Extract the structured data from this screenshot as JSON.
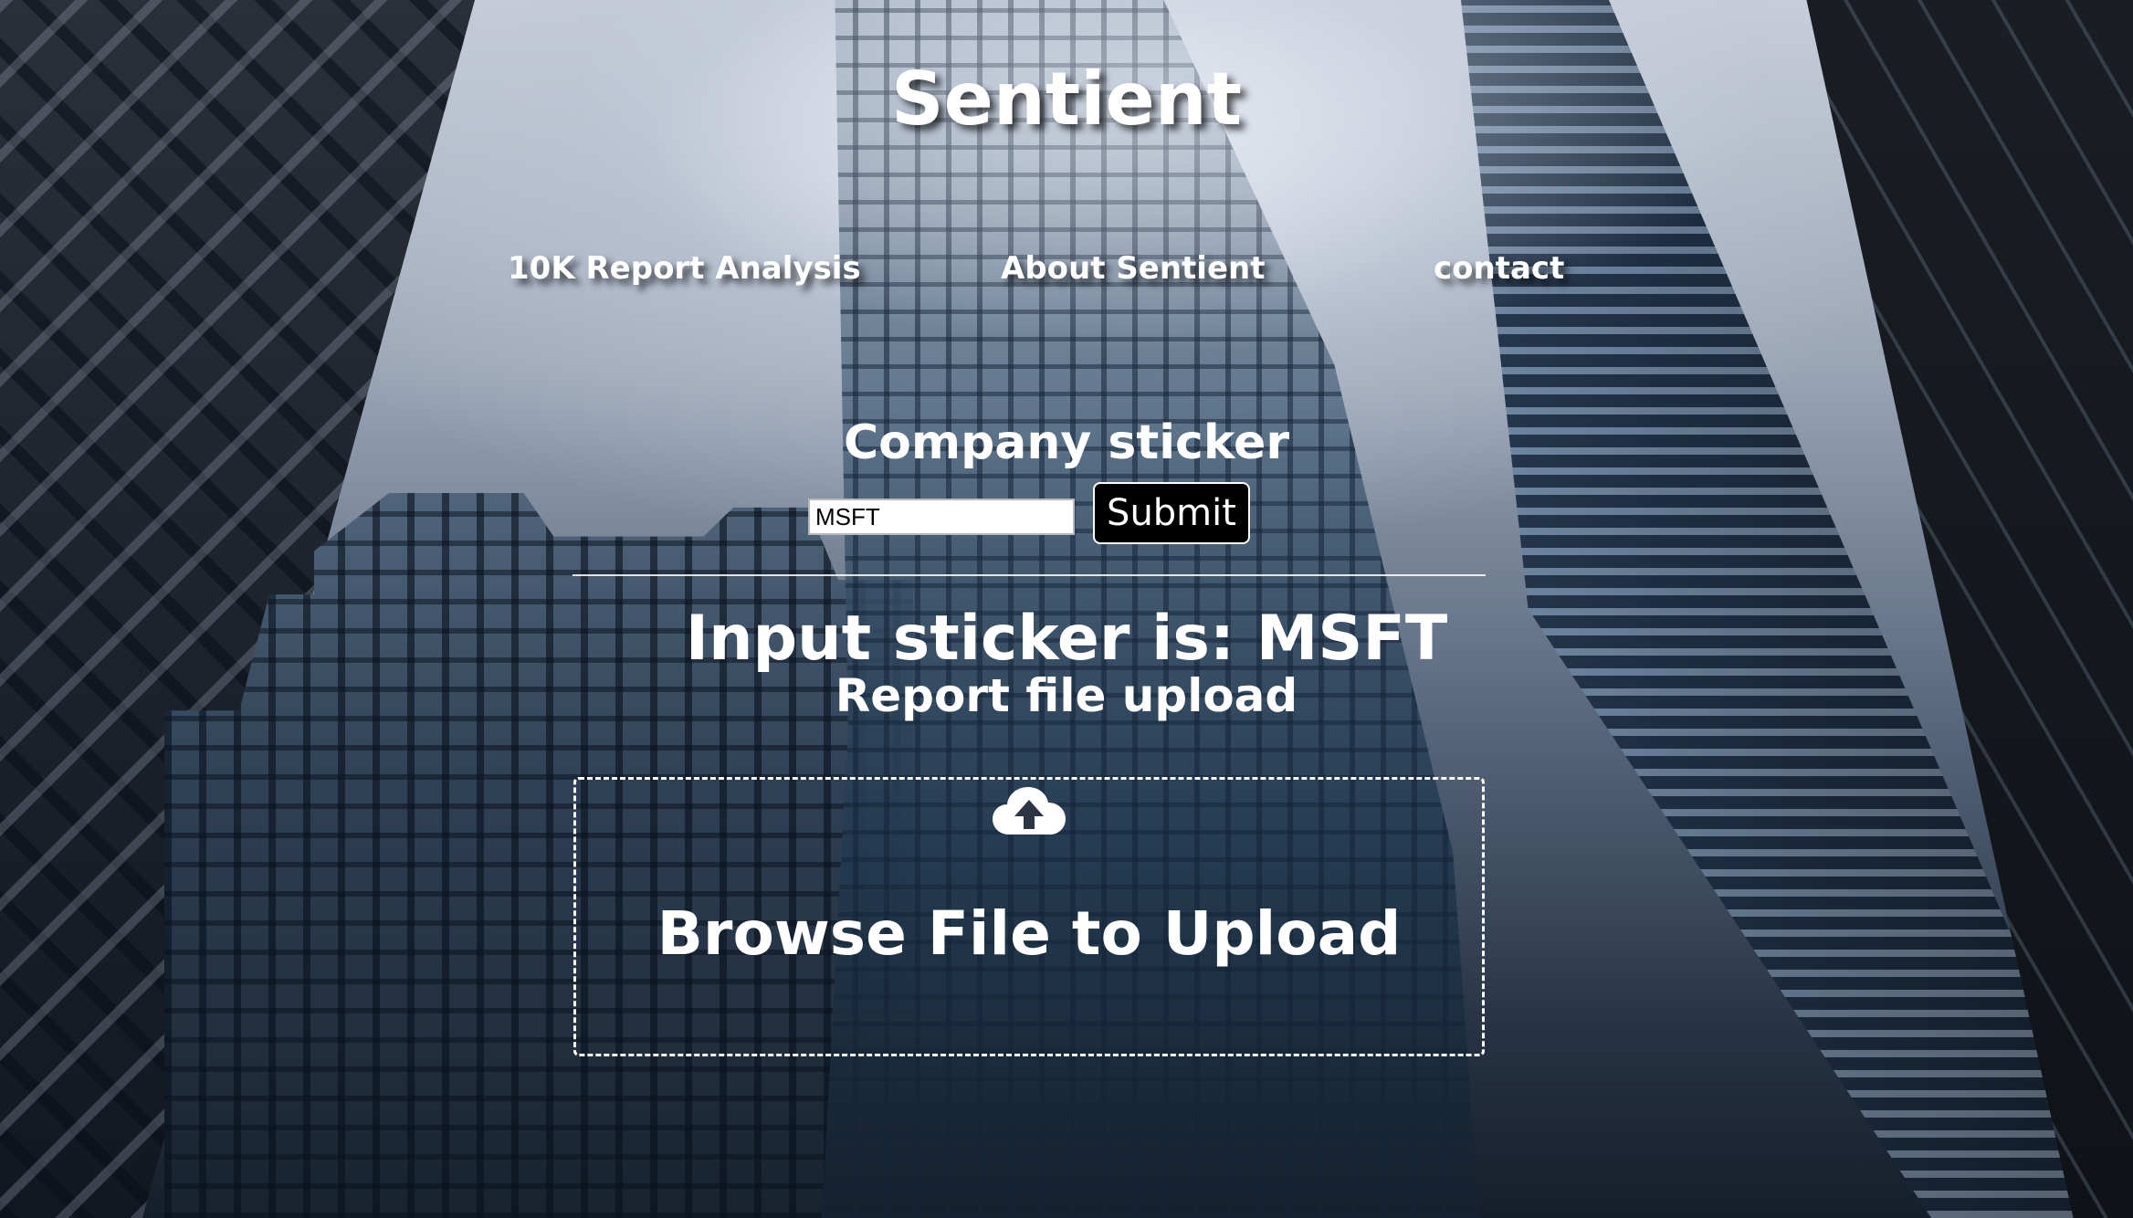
{
  "site": {
    "title": "Sentient"
  },
  "nav": {
    "items": [
      {
        "label": "10K Report Analysis"
      },
      {
        "label": "About Sentient"
      },
      {
        "label": "contact"
      }
    ]
  },
  "ticker_form": {
    "label": "Company sticker",
    "input_value": "MSFT",
    "submit_label": "Submit"
  },
  "result": {
    "text": "Input sticker is: MSFT"
  },
  "upload": {
    "heading": "Report file upload",
    "icon": "cloud-upload-icon",
    "browse_label": "Browse File to Upload"
  },
  "colors": {
    "text": "#ffffff",
    "button_bg": "#000000",
    "input_bg": "#ffffff"
  }
}
